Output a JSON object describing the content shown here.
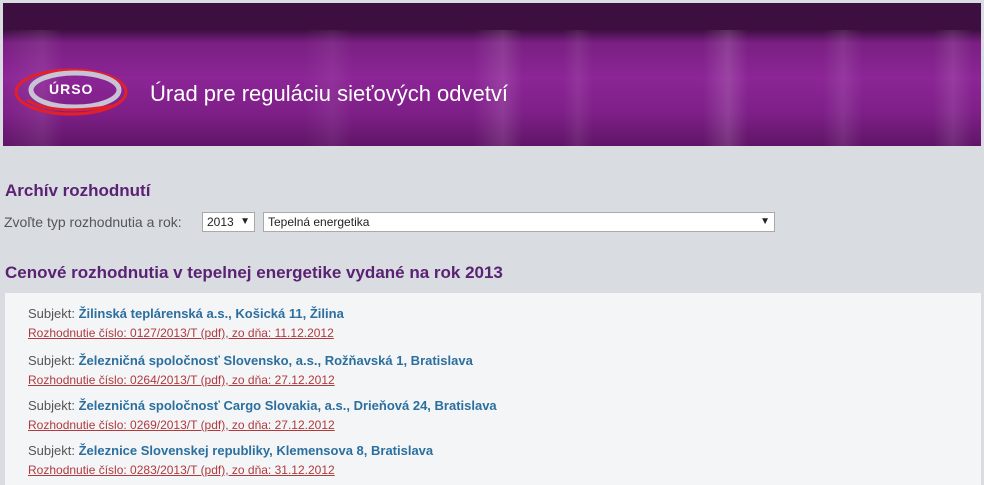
{
  "header": {
    "logo_text": "ÚRSO",
    "title": "Úrad pre reguláciu sieťových odvetví"
  },
  "archive": {
    "title": "Archív rozhodnutí",
    "filter_label": "Zvoľte typ rozhodnutia a rok:",
    "year_selected": "2013",
    "type_selected": "Tepelná energetika"
  },
  "decisions": {
    "title": "Cenové rozhodnutia v tepelnej energetike vydané na rok 2013",
    "subject_prefix": "Subjekt:",
    "items": [
      {
        "subject": "Žilinská teplárenská a.s., Košická 11, Žilina",
        "link": "Rozhodnutie číslo: 0127/2013/T (pdf), zo dňa: 11.12.2012"
      },
      {
        "subject": "Železničná spoločnosť Slovensko, a.s., Rožňavská 1, Bratislava",
        "link": "Rozhodnutie číslo: 0264/2013/T (pdf), zo dňa: 27.12.2012"
      },
      {
        "subject": "Železničná spoločnosť Cargo Slovakia, a.s., Drieňová 24, Bratislava",
        "link": "Rozhodnutie číslo: 0269/2013/T (pdf), zo dňa: 27.12.2012"
      },
      {
        "subject": "Železnice Slovenskej republiky, Klemensova 8, Bratislava",
        "link": "Rozhodnutie číslo: 0283/2013/T (pdf), zo dňa: 31.12.2012"
      }
    ]
  },
  "colors": {
    "header_purple": "#8c2596",
    "heading": "#5b2173",
    "subject_link": "#2c6f9e",
    "decision_link": "#b03a3e"
  }
}
